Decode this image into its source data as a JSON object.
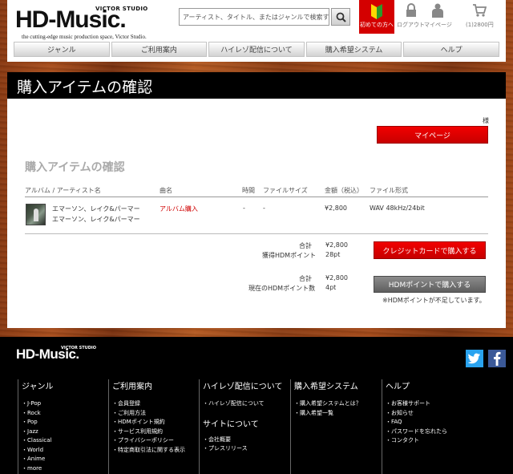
{
  "header": {
    "logo_sub": "VICTOR STUDIO",
    "logo_main": "HD-Music.",
    "logo_tagline": "the cutting-edge music production space, Victor Studio.",
    "search_placeholder": "アーティスト、タイトル、またはジャンルで検索する",
    "beginner_label": "初めての方へ",
    "logout_label": "ログアウト",
    "mypage_label": "マイページ",
    "cart_label": "(1)2800円"
  },
  "nav": {
    "items": [
      "ジャンル",
      "ご利用案内",
      "ハイレゾ配信について",
      "購入希望システム",
      "ヘルプ"
    ]
  },
  "page": {
    "title": "購入アイテムの確認",
    "sama": "様",
    "mypage_button": "マイページ",
    "section_title": "購入アイテムの確認"
  },
  "table": {
    "headers": {
      "album": "アルバム / アーティスト名",
      "song": "曲名",
      "time": "時間",
      "size": "ファイルサイズ",
      "price": "金額（税込）",
      "format": "ファイル形式"
    },
    "rows": [
      {
        "album": "エマーソン、レイク&パーマー",
        "artist": "エマーソン、レイク&パーマー",
        "song": "アルバム購入",
        "time": "-",
        "size": "-",
        "price": "¥2,800",
        "format": "WAV 48kHz/24bit"
      }
    ]
  },
  "summary": {
    "credit": {
      "total_label": "合計",
      "total_value": "¥2,800",
      "points_label": "獲得HDMポイント",
      "points_value": "28pt",
      "button": "クレジットカードで購入する"
    },
    "hdm": {
      "total_label": "合計",
      "total_value": "¥2,800",
      "points_label": "現在のHDMポイント数",
      "points_value": "4pt",
      "button": "HDMポイントで購入する",
      "note": "※HDMポイントが不足しています。"
    }
  },
  "footer": {
    "logo_sub": "VICTOR STUDIO",
    "logo_main": "HD-Music.",
    "columns": [
      {
        "heading": "ジャンル",
        "links": [
          "J-Pop",
          "Rock",
          "Pop",
          "Jazz",
          "Classical",
          "World",
          "Anime",
          "more"
        ]
      },
      {
        "heading": "ご利用案内",
        "links": [
          "会員登録",
          "ご利用方法",
          "HDMポイント規約",
          "サービス利用規約",
          "プライバシーポリシー",
          "特定商取引法に関する表示"
        ]
      },
      {
        "heading": "ハイレゾ配信について",
        "links": [
          "ハイレゾ配信について"
        ],
        "subheading": "サイトについて",
        "sublinks": [
          "会社概要",
          "プレスリリース"
        ]
      },
      {
        "heading": "購入希望システム",
        "links": [
          "購入希望システムとは？",
          "購入希望一覧"
        ]
      },
      {
        "heading": "ヘルプ",
        "links": [
          "お客様サポート",
          "お知らせ",
          "FAQ",
          "パスワードを忘れたら",
          "コンタクト"
        ]
      }
    ]
  },
  "colors": {
    "accent_red": "#d40000",
    "footer_bg": "#000000",
    "twitter": "#2aa3ef",
    "facebook": "#3b5998"
  },
  "icons": {
    "search": "search-icon",
    "beginner": "beginner-mark-icon",
    "logout": "lock-icon",
    "mypage": "person-icon",
    "cart": "cart-icon",
    "twitter": "twitter-icon",
    "facebook": "facebook-icon"
  }
}
